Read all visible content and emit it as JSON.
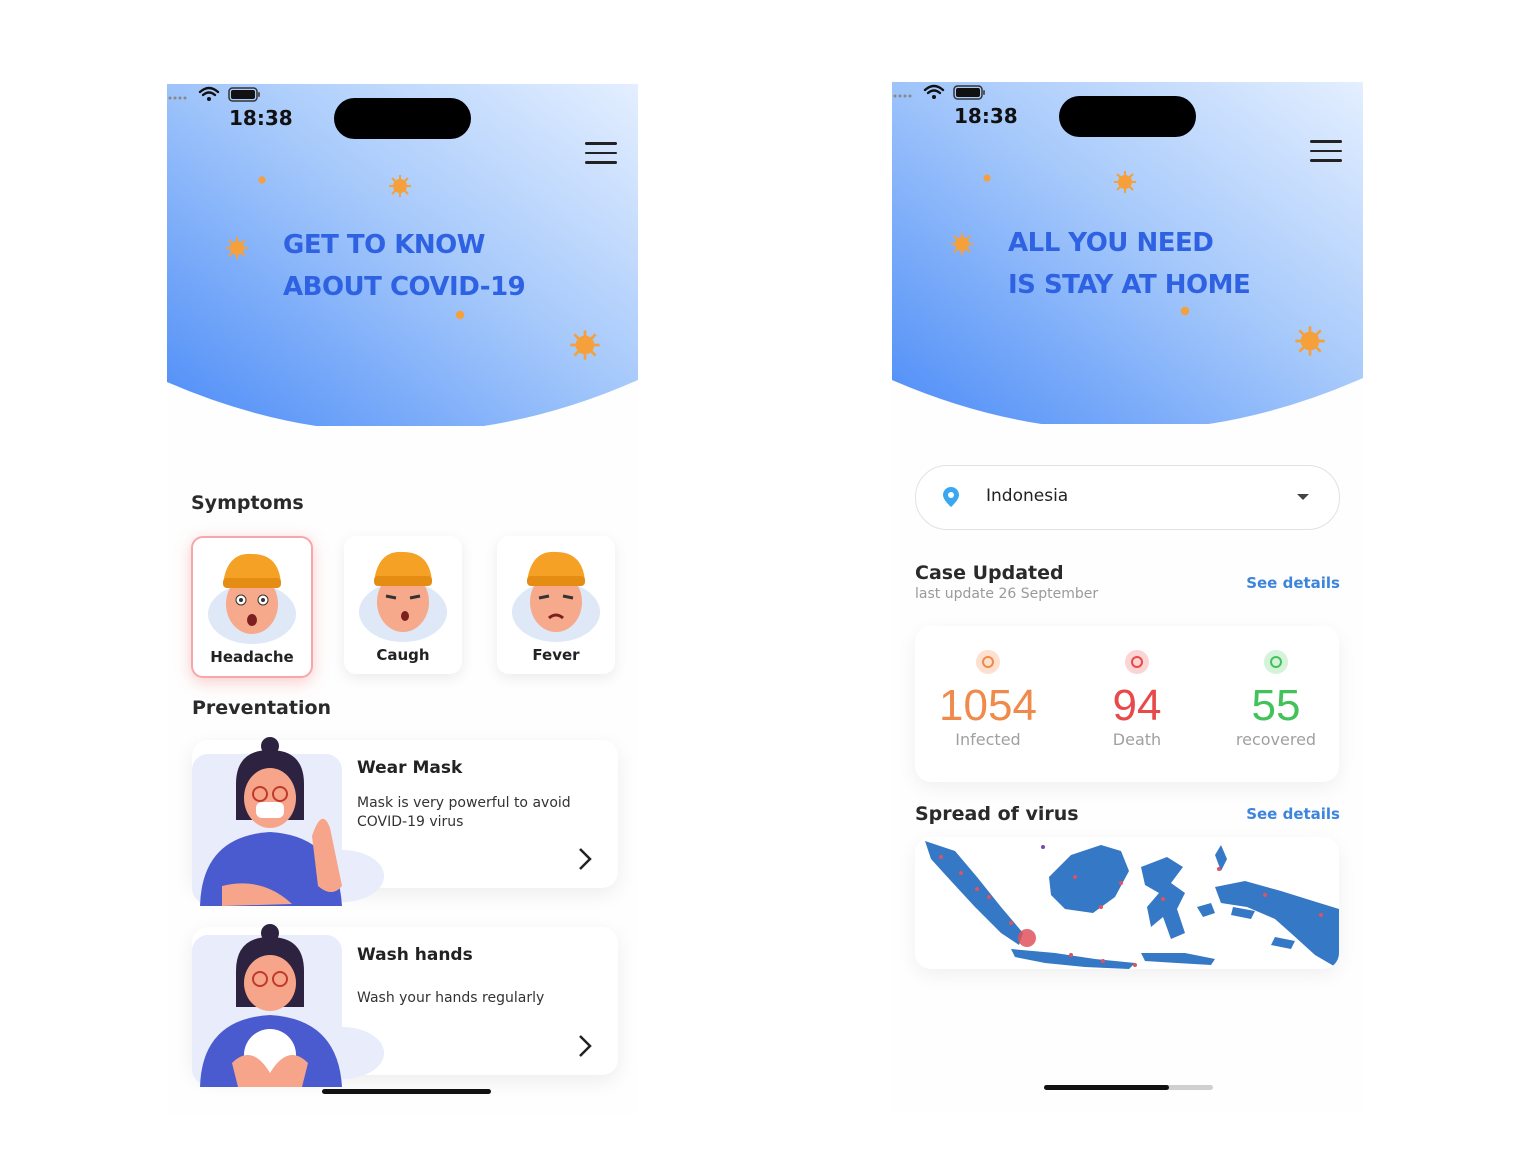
{
  "left": {
    "status_time": "18:38",
    "hero_line1": "GET TO KNOW",
    "hero_line2": "ABOUT COVID-19",
    "symptoms_title": "Symptoms",
    "symptoms": [
      {
        "label": "Headache",
        "active": true
      },
      {
        "label": "Caugh",
        "active": false
      },
      {
        "label": "Fever",
        "active": false
      }
    ],
    "prevention_title": "Preventation",
    "prevention": [
      {
        "title": "Wear Mask",
        "desc": "Mask is very powerful to avoid COVID-19 virus"
      },
      {
        "title": "Wash hands",
        "desc": "Wash your hands regularly"
      }
    ]
  },
  "right": {
    "status_time": "18:38",
    "hero_line1": "ALL YOU NEED",
    "hero_line2": "IS STAY AT HOME",
    "country": "Indonesia",
    "case_title": "Case Updated",
    "case_sub": "last update 26 September",
    "see_details": "See details",
    "stats": [
      {
        "value": "1054",
        "label": "Infected",
        "color": "#f08a4b",
        "ring": "#fde0cf"
      },
      {
        "value": "94",
        "label": "Death",
        "color": "#e84a4a",
        "ring": "#fbd4d4"
      },
      {
        "value": "55",
        "label": "recovered",
        "color": "#43c25a",
        "ring": "#d4f3da"
      }
    ],
    "spread_title": "Spread of virus",
    "spread_link": "See details"
  },
  "colors": {
    "accent": "#2f62e3",
    "link": "#3d84dc",
    "virus": "#f5a03a",
    "map": "#3478c6",
    "map_dot": "#e0525c"
  }
}
